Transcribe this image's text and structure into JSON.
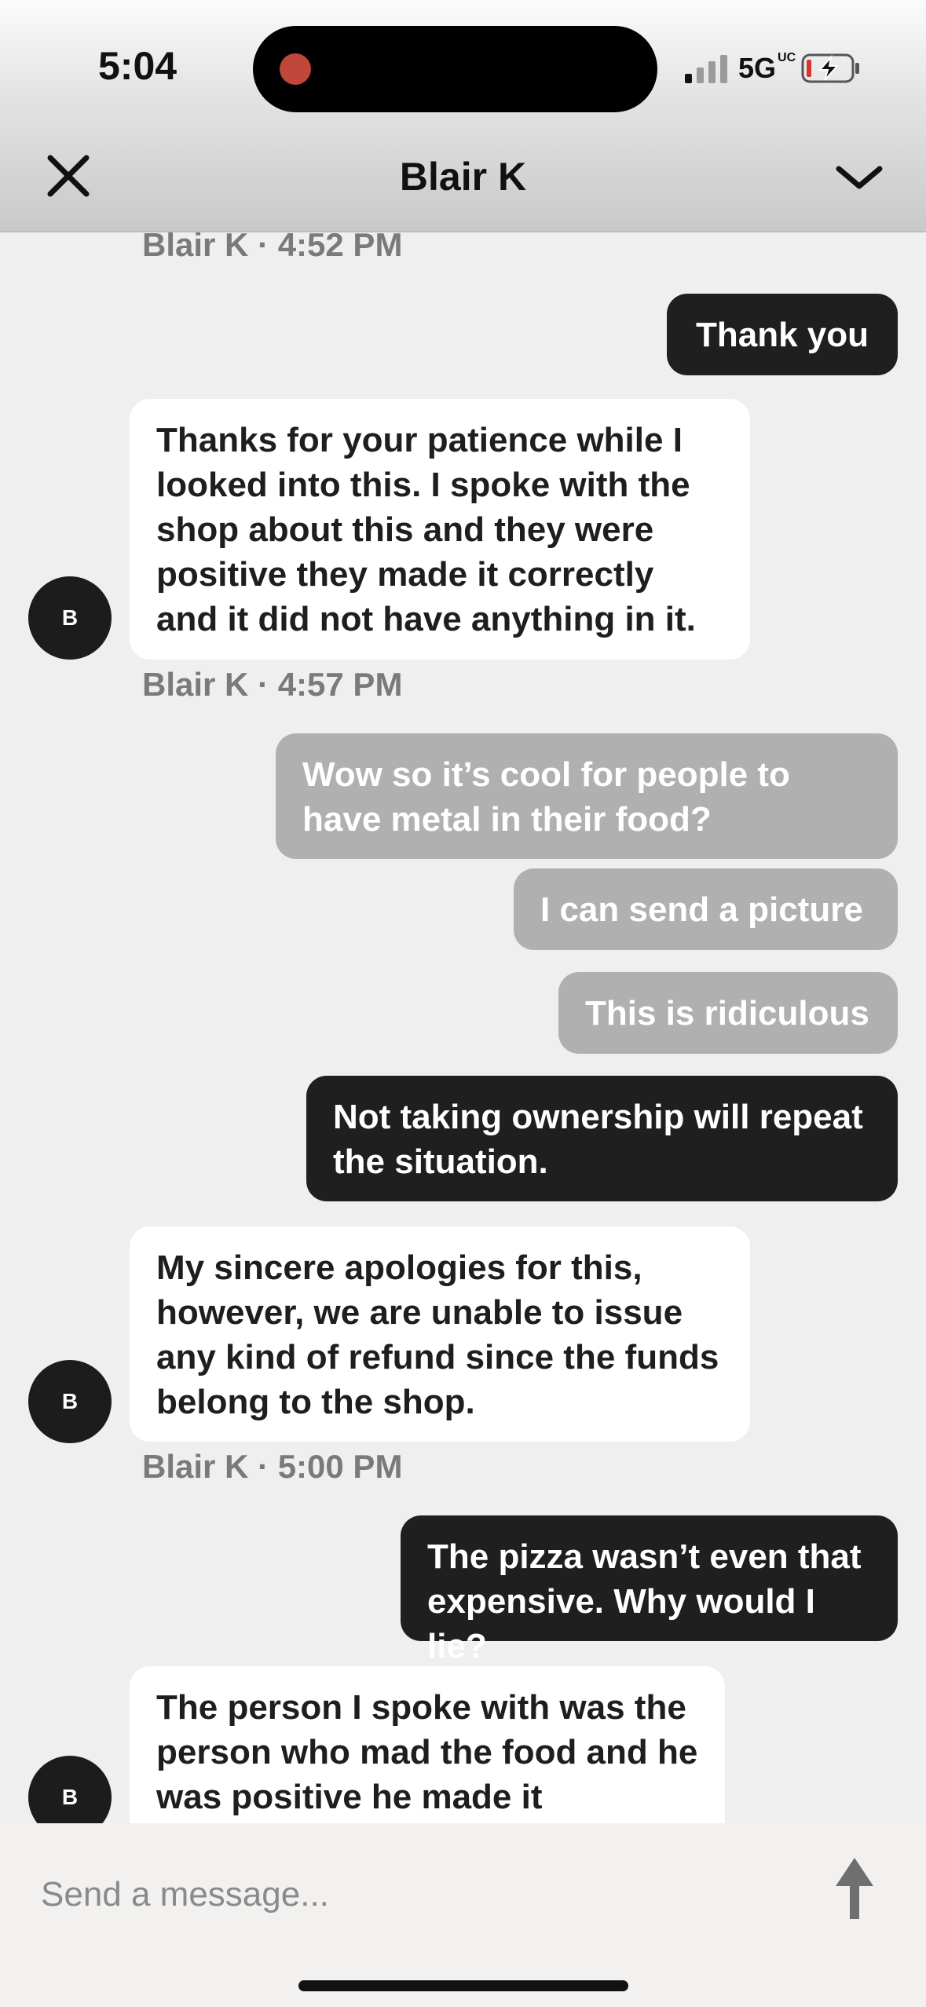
{
  "status_bar": {
    "time": "5:04",
    "network": "5G",
    "network_sup": "UC"
  },
  "header": {
    "title": "Blair K"
  },
  "messages": [
    {
      "meta": "Blair K · 4:52 PM"
    },
    {
      "text": "Thank you"
    },
    {
      "text": "Thanks for your patience while I looked into this. I spoke with the shop about this and they were positive they made it correctly and it did not have anything in it.",
      "avatar": "B"
    },
    {
      "meta": "Blair K · 4:57 PM"
    },
    {
      "text": "Wow so it’s cool for people to have metal in their food?"
    },
    {
      "text": "I can send a picture"
    },
    {
      "text": "This is ridiculous"
    },
    {
      "text": "Not taking ownership will repeat the situation."
    },
    {
      "text": "My sincere apologies for this, however, we are unable to issue any kind of refund since the funds belong to the shop.",
      "avatar": "B"
    },
    {
      "meta": "Blair K · 5:00 PM"
    },
    {
      "text": "The pizza wasn’t even that expensive. Why would I lie?"
    },
    {
      "text": "The person I spoke with was the person who mad the food and he was positive he made it correctly.",
      "avatar": "B"
    }
  ],
  "composer": {
    "placeholder": "Send a message..."
  },
  "colors": {
    "outgoing_dark": "#1f1f1f",
    "outgoing_pending": "#b0b0b0",
    "incoming": "#ffffff",
    "background": "#efefef"
  }
}
